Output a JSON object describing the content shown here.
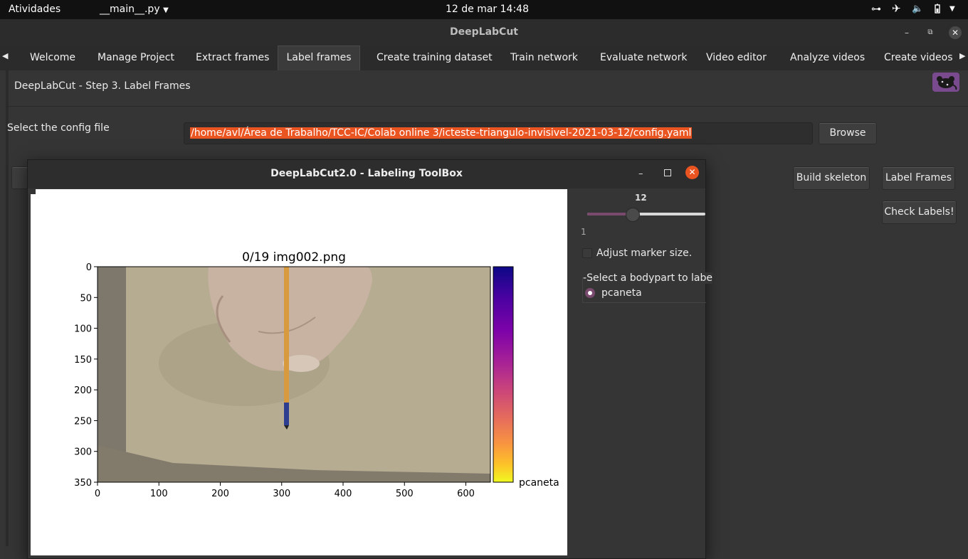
{
  "topbar": {
    "activities": "Atividades",
    "app_menu": "__main__.py",
    "clock": "12 de mar  14:48"
  },
  "window": {
    "title": "DeepLabCut"
  },
  "tabs": [
    {
      "label": "Welcome"
    },
    {
      "label": "Manage Project"
    },
    {
      "label": "Extract frames"
    },
    {
      "label": "Label frames"
    },
    {
      "label": "Create training dataset"
    },
    {
      "label": "Train network"
    },
    {
      "label": "Evaluate network"
    },
    {
      "label": "Video editor"
    },
    {
      "label": "Analyze videos"
    },
    {
      "label": "Create videos"
    }
  ],
  "main": {
    "step_title": "DeepLabCut - Step 3. Label Frames",
    "config_label": "Select the config file",
    "config_path": "/home/avl/Área de Trabalho/TCC-IC/Colab online 3/icteste-triangulo-invisivel-2021-03-12/config.yaml",
    "browse_label": "Browse",
    "build_skeleton_label": "Build skeleton",
    "label_frames_label": "Label Frames",
    "check_labels_label": "Check Labels!"
  },
  "dialog": {
    "title": "DeepLabCut2.0 - Labeling ToolBox",
    "slider": {
      "value": "12",
      "min_label": "1",
      "value_num": 12,
      "min": 1,
      "max": 30
    },
    "adjust_marker_label": "Adjust marker size.",
    "bodypart_group_label": "Select a bodypart to labe",
    "bodyparts": [
      {
        "label": "pcaneta",
        "selected": true
      }
    ]
  },
  "chart_data": {
    "type": "image",
    "title": "0/19 img002.png",
    "xticks": [
      "0",
      "100",
      "200",
      "300",
      "400",
      "500",
      "600"
    ],
    "yticks": [
      "0",
      "50",
      "100",
      "150",
      "200",
      "250",
      "300",
      "350"
    ],
    "xlim": [
      0,
      640
    ],
    "ylim": [
      350,
      0
    ],
    "colorbar": {
      "label": "pcaneta",
      "colormap": "plasma"
    }
  },
  "colors": {
    "accent": "#e95420",
    "slider": "#7a4a6e",
    "bg": "#353535"
  }
}
